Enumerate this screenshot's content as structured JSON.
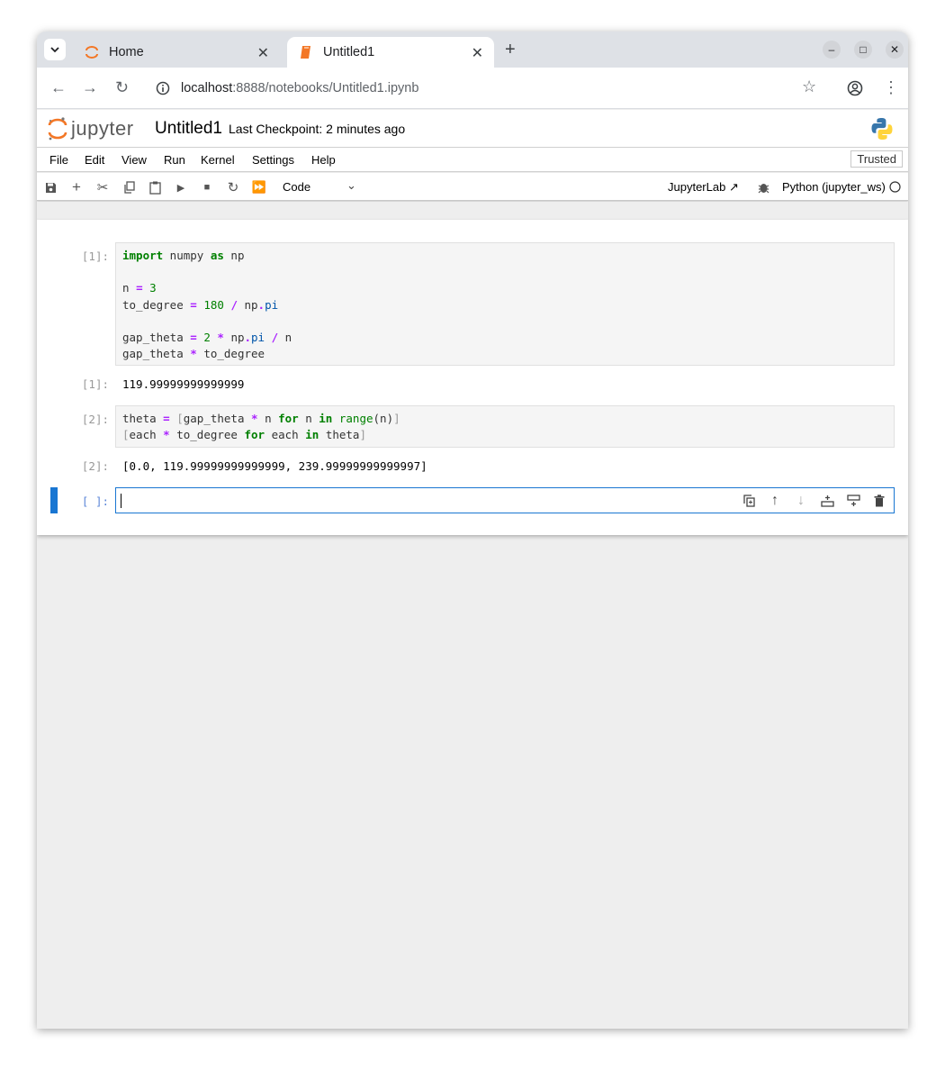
{
  "browser": {
    "tabs": [
      {
        "title": "Home",
        "active": false
      },
      {
        "title": "Untitled1",
        "active": true
      }
    ],
    "url_host": "localhost",
    "url_rest": ":8888/notebooks/Untitled1.ipynb"
  },
  "jupyter": {
    "logo_text": "jupyter",
    "notebook_title": "Untitled1",
    "checkpoint": "Last Checkpoint: 2 minutes ago",
    "menu": [
      "File",
      "Edit",
      "View",
      "Run",
      "Kernel",
      "Settings",
      "Help"
    ],
    "trusted": "Trusted",
    "cell_type": "Code",
    "jupyterlab_label": "JupyterLab",
    "kernel_name": "Python (jupyter_ws)"
  },
  "cells": [
    {
      "in_prompt": "[1]:",
      "out_prompt": "[1]:",
      "output": "119.99999999999999"
    },
    {
      "in_prompt": "[2]:",
      "out_prompt": "[2]:",
      "output": "[0.0, 119.99999999999999, 239.99999999999997]"
    },
    {
      "in_prompt": "[ ]:"
    }
  ]
}
